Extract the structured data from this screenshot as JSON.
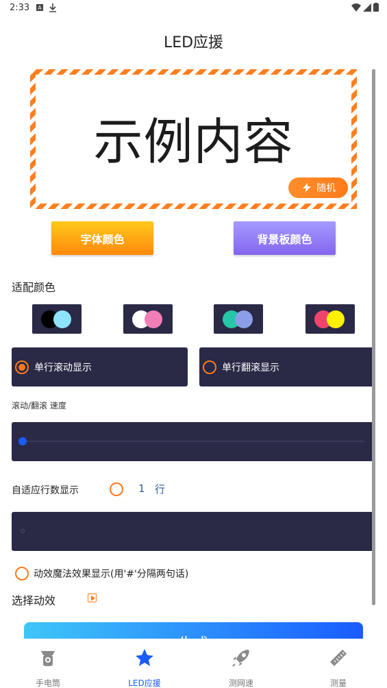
{
  "status_bar": {
    "time": "2:33"
  },
  "app_title": "LED应援",
  "preview": {
    "text": "示例内容",
    "random_label": "随机"
  },
  "buttons": {
    "font_color": "字体颜色",
    "bg_color": "背景板颜色"
  },
  "color_section": {
    "label": "适配颜色",
    "swatches": [
      {
        "a": "#000000",
        "b": "#8fe3ff"
      },
      {
        "a": "#ffffff",
        "b": "#f07fb8"
      },
      {
        "a": "#26c7a6",
        "b": "#8b9ee8"
      },
      {
        "a": "#f0446e",
        "b": "#fff200"
      }
    ]
  },
  "display_modes": [
    {
      "label": "单行滚动显示",
      "checked": true
    },
    {
      "label": "单行翻滚显示",
      "checked": false
    }
  ],
  "speed": {
    "label": "滚动/翻滚 速度",
    "value": 0
  },
  "rows": {
    "label": "自适应行数显示",
    "count": "1",
    "unit": "行"
  },
  "magic_effect": {
    "label": "动效魔法效果显示(用'#'分隔两句话)"
  },
  "effect": {
    "label": "选择动效"
  },
  "generate_label": "生成",
  "nav": [
    {
      "label": "手电筒",
      "icon": "flashlight-icon",
      "active": false
    },
    {
      "label": "LED应援",
      "icon": "star-icon",
      "active": true
    },
    {
      "label": "测网速",
      "icon": "rocket-icon",
      "active": false
    },
    {
      "label": "测量",
      "icon": "ruler-icon",
      "active": false
    }
  ],
  "colors": {
    "accent": "#ff7a1a",
    "panel": "#2a2946",
    "primary": "#1a5cff"
  }
}
